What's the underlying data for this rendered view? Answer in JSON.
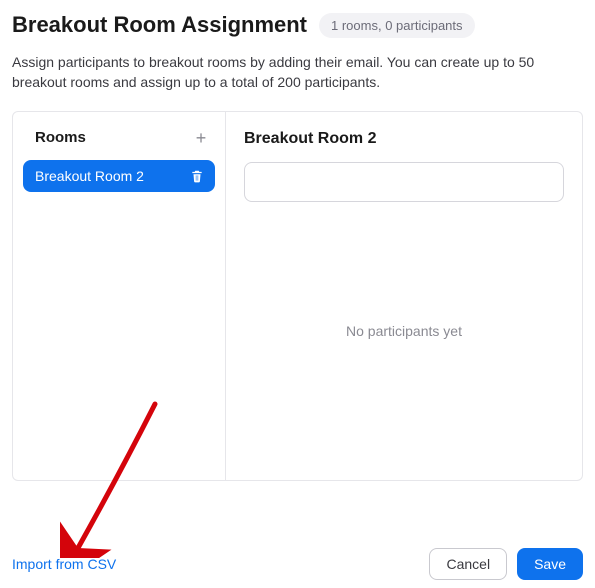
{
  "header": {
    "title": "Breakout Room Assignment",
    "count_text": "1 rooms, 0 participants"
  },
  "description": "Assign participants to breakout rooms by adding their email. You can create up to 50 breakout rooms and assign up to a total of 200 participants.",
  "sidebar": {
    "label": "Rooms",
    "add_icon": "+",
    "rooms": [
      {
        "name": "Breakout Room 2"
      }
    ]
  },
  "detail": {
    "title": "Breakout Room 2",
    "input_value": "",
    "empty_text": "No participants yet"
  },
  "footer": {
    "import_label": "Import from CSV",
    "cancel_label": "Cancel",
    "save_label": "Save"
  },
  "colors": {
    "primary": "#0e72ed"
  }
}
